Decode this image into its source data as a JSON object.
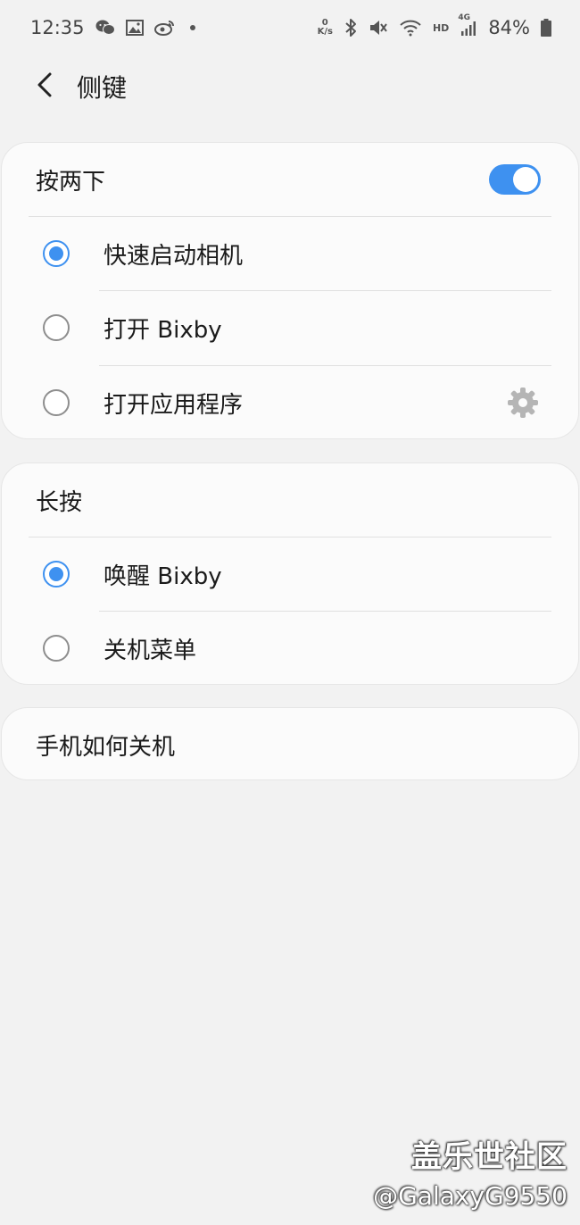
{
  "status_bar": {
    "time": "12:35",
    "net_speed_value": "0",
    "net_speed_unit": "K/s",
    "hd_label": "HD",
    "network_label": "4G",
    "battery": "84%",
    "icons": [
      "wechat-icon",
      "gallery-icon",
      "weibo-icon",
      "dot-icon",
      "bluetooth-icon",
      "mute-icon",
      "wifi-icon",
      "signal-icon",
      "battery-icon"
    ]
  },
  "app_bar": {
    "title": "侧键"
  },
  "double_press": {
    "header": "按两下",
    "toggle_on": true,
    "options": [
      {
        "label": "快速启动相机",
        "selected": true
      },
      {
        "label": "打开 Bixby",
        "selected": false
      },
      {
        "label": "打开应用程序",
        "selected": false
      }
    ]
  },
  "long_press": {
    "header": "长按",
    "options": [
      {
        "label": "唤醒 Bixby",
        "selected": true
      },
      {
        "label": "关机菜单",
        "selected": false
      }
    ]
  },
  "power_off_help": {
    "label": "手机如何关机"
  },
  "watermark": {
    "line1": "盖乐世社区",
    "line2": "@GalaxyG9550"
  },
  "colors": {
    "accent": "#3e91f0",
    "background": "#f2f2f2",
    "card": "#fbfbfb"
  }
}
